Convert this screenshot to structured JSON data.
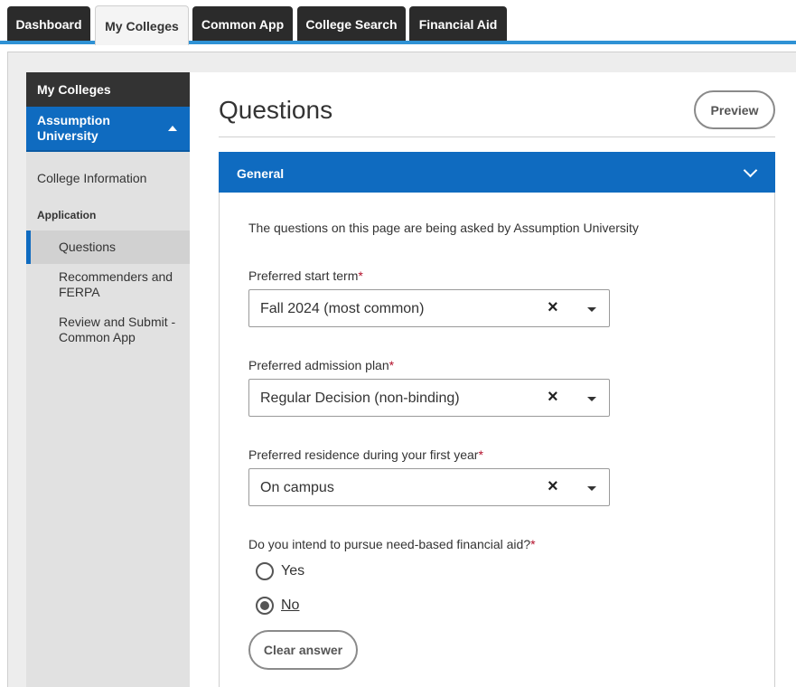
{
  "tabs": [
    {
      "label": "Dashboard"
    },
    {
      "label": "My Colleges",
      "active": true
    },
    {
      "label": "Common App"
    },
    {
      "label": "College Search"
    },
    {
      "label": "Financial Aid"
    }
  ],
  "sidebar": {
    "header": "My Colleges",
    "college": "Assumption University",
    "college_info": "College Information",
    "section": "Application",
    "items": [
      {
        "label": "Questions",
        "active": true
      },
      {
        "label": "Recommenders and FERPA"
      },
      {
        "label": "Review and Submit - Common App"
      }
    ]
  },
  "main": {
    "title": "Questions",
    "preview_label": "Preview",
    "section_title": "General",
    "intro": "The questions on this page are being asked by Assumption University",
    "questions": [
      {
        "label": "Preferred start term",
        "required": "*",
        "value": "Fall 2024 (most common)"
      },
      {
        "label": "Preferred admission plan",
        "required": "*",
        "value": "Regular Decision (non-binding)"
      },
      {
        "label": "Preferred residence during your first year",
        "required": "*",
        "value": "On campus"
      }
    ],
    "aid_question": {
      "label": "Do you intend to pursue need-based financial aid?",
      "required": "*",
      "options": [
        {
          "label": "Yes",
          "checked": false
        },
        {
          "label": "No",
          "checked": true
        }
      ],
      "clear_label": "Clear answer"
    },
    "clear_icon": "×"
  },
  "colors": {
    "accent_blue": "#0f6bc0",
    "tab_underline": "#2f92d5",
    "tab_dark": "#2b2b2b",
    "required_red": "#b3102b"
  },
  "icons": {
    "select_clear": "close-icon",
    "select_toggle": "caret-down-icon",
    "section_toggle": "chevron-down-icon",
    "college_toggle": "caret-up-icon"
  }
}
